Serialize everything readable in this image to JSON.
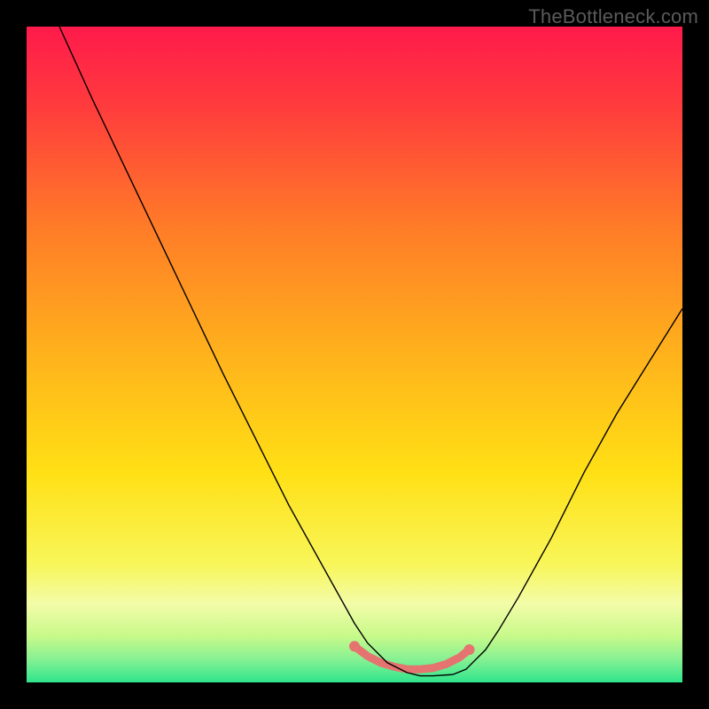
{
  "watermark": "TheBottleneck.com",
  "chart_data": {
    "type": "line",
    "title": "",
    "xlabel": "",
    "ylabel": "",
    "xlim": [
      0,
      100
    ],
    "ylim": [
      0,
      100
    ],
    "grid": false,
    "legend": null,
    "gradient_stops": [
      {
        "offset": 0.0,
        "color": "#ff1a4b"
      },
      {
        "offset": 0.12,
        "color": "#ff3b3d"
      },
      {
        "offset": 0.3,
        "color": "#ff7a28"
      },
      {
        "offset": 0.5,
        "color": "#ffb21c"
      },
      {
        "offset": 0.68,
        "color": "#ffe015"
      },
      {
        "offset": 0.82,
        "color": "#f8f65a"
      },
      {
        "offset": 0.88,
        "color": "#f3fca8"
      },
      {
        "offset": 0.93,
        "color": "#c7f98a"
      },
      {
        "offset": 0.965,
        "color": "#86f193"
      },
      {
        "offset": 1.0,
        "color": "#2fe58c"
      }
    ],
    "series": [
      {
        "name": "bottleneck-curve",
        "stroke": "#000000",
        "stroke_width": 1.4,
        "x": [
          5,
          10,
          15,
          20,
          25,
          30,
          35,
          40,
          45,
          50,
          52,
          55,
          58,
          60,
          62,
          65,
          67,
          70,
          72,
          75,
          80,
          85,
          90,
          95,
          100
        ],
        "y": [
          100,
          89,
          78.5,
          68,
          57.5,
          47,
          37,
          27,
          18,
          9,
          6,
          3,
          1.5,
          1,
          1,
          1.2,
          2,
          5,
          8,
          13,
          22,
          32,
          41,
          49,
          57
        ]
      }
    ],
    "annotations": [
      {
        "name": "valley-highlight",
        "stroke": "#e5736f",
        "stroke_width": 9,
        "linecap": "round",
        "points_x": [
          50,
          52,
          54,
          56,
          58,
          60,
          62,
          64,
          66,
          67.5
        ],
        "points_y": [
          5.5,
          4,
          3,
          2.4,
          2,
          2,
          2.2,
          2.8,
          3.8,
          5
        ]
      },
      {
        "name": "valley-dot-1",
        "type": "dot",
        "fill": "#e5736f",
        "r": 6,
        "x": 50,
        "y": 5.5
      },
      {
        "name": "valley-dot-2",
        "type": "dot",
        "fill": "#e5736f",
        "r": 6,
        "x": 67.5,
        "y": 5
      }
    ]
  }
}
